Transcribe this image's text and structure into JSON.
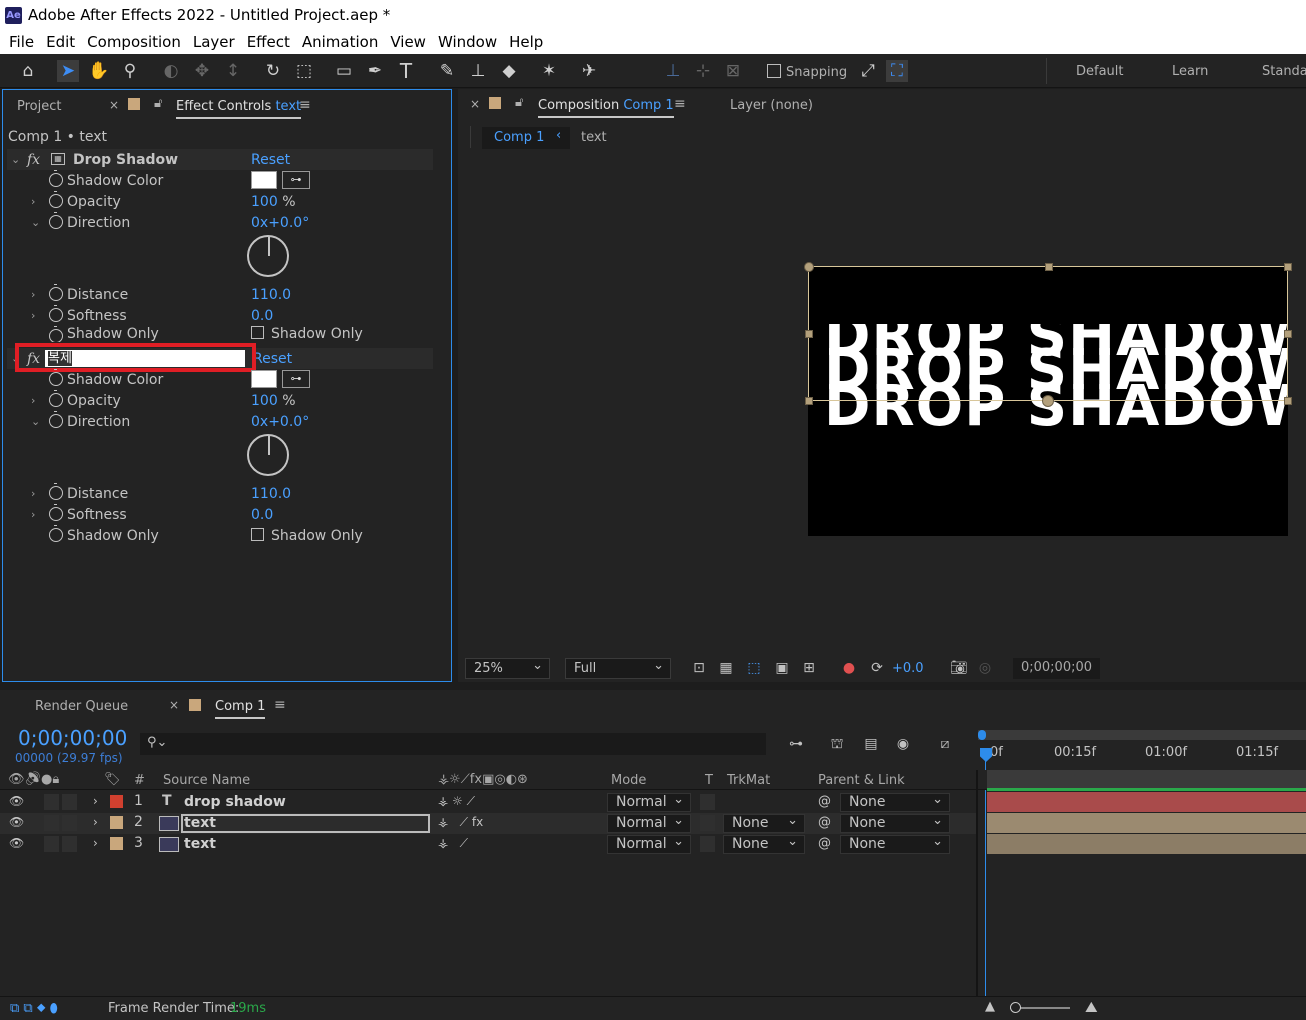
{
  "window": {
    "title": "Adobe After Effects 2022 - Untitled Project.aep *",
    "logo": "Ae"
  },
  "menu": [
    "File",
    "Edit",
    "Composition",
    "Layer",
    "Effect",
    "Animation",
    "View",
    "Window",
    "Help"
  ],
  "toolbar": {
    "snapping_label": "Snapping",
    "workspaces": [
      "Default",
      "Learn",
      "Standar"
    ],
    "icons": [
      "home-icon",
      "selection-tool-icon",
      "hand-tool-icon",
      "zoom-tool-icon",
      "orbit-camera-icon",
      "pan-camera-icon",
      "dolly-camera-icon",
      "rotate-tool-icon",
      "pan-behind-icon",
      "rectangle-tool-icon",
      "pen-tool-icon",
      "type-tool-icon",
      "brush-tool-icon",
      "clone-stamp-icon",
      "eraser-icon",
      "roto-brush-icon",
      "puppet-pin-icon"
    ]
  },
  "left_panel": {
    "tab_project": "Project",
    "tab_effect_controls": "Effect Controls",
    "tab_effect_controls_target": "text",
    "breadcrumb": "Comp 1 • text",
    "effect1": {
      "name": "Drop Shadow",
      "reset": "Reset",
      "props": {
        "shadow_color": "Shadow Color",
        "opacity": "Opacity",
        "opacity_val": "100",
        "opacity_unit": "%",
        "direction": "Direction",
        "direction_val": "0x+0.0°",
        "distance": "Distance",
        "distance_val": "110.0",
        "softness": "Softness",
        "softness_val": "0.0",
        "shadow_only": "Shadow Only",
        "shadow_only_cb": "Shadow Only"
      }
    },
    "effect2": {
      "rename_value": "복제",
      "reset": "Reset",
      "props": {
        "shadow_color": "Shadow Color",
        "opacity": "Opacity",
        "opacity_val": "100",
        "opacity_unit": "%",
        "direction": "Direction",
        "direction_val": "0x+0.0°",
        "distance": "Distance",
        "distance_val": "110.0",
        "softness": "Softness",
        "softness_val": "0.0",
        "shadow_only": "Shadow Only",
        "shadow_only_cb": "Shadow Only"
      }
    }
  },
  "comp_panel": {
    "tab_composition": "Composition",
    "tab_composition_name": "Comp 1",
    "tab_layer": "Layer (none)",
    "crumb_comp": "Comp 1",
    "crumb_layer": "text",
    "canvas_text": "DROP SHADOW",
    "zoom": "25%",
    "resolution": "Full",
    "exposure": "+0.0",
    "timecode": "0;00;00;00"
  },
  "timeline": {
    "tab_render_queue": "Render Queue",
    "tab_comp": "Comp 1",
    "timecode": "0;00;00;00",
    "frame_info": "00000 (29.97 fps)",
    "search_placeholder": "",
    "headers": {
      "number": "#",
      "source_name": "Source Name",
      "mode": "Mode",
      "t": "T",
      "trkmat": "TrkMat",
      "parent": "Parent & Link"
    },
    "ruler": [
      "0f",
      "00:15f",
      "01:00f",
      "01:15f"
    ],
    "layers": [
      {
        "num": "1",
        "type_icon": "T",
        "name": "drop shadow",
        "mode": "Normal",
        "trkmat": "",
        "parent": "None",
        "label_color": "#d1402f",
        "bar_color": "#a94b4b"
      },
      {
        "num": "2",
        "type_icon": "comp",
        "name": "text",
        "mode": "Normal",
        "trkmat": "None",
        "parent": "None",
        "label_color": "#c9a77c",
        "bar_color": "#9b8a70"
      },
      {
        "num": "3",
        "type_icon": "comp",
        "name": "text",
        "mode": "Normal",
        "trkmat": "None",
        "parent": "None",
        "label_color": "#c9a77c",
        "bar_color": "#8c7d66"
      }
    ]
  },
  "status": {
    "label": "Frame Render Time:",
    "value": "19ms"
  },
  "colors": {
    "accent": "#2d8ceb",
    "highlight_box": "#e01e25"
  }
}
